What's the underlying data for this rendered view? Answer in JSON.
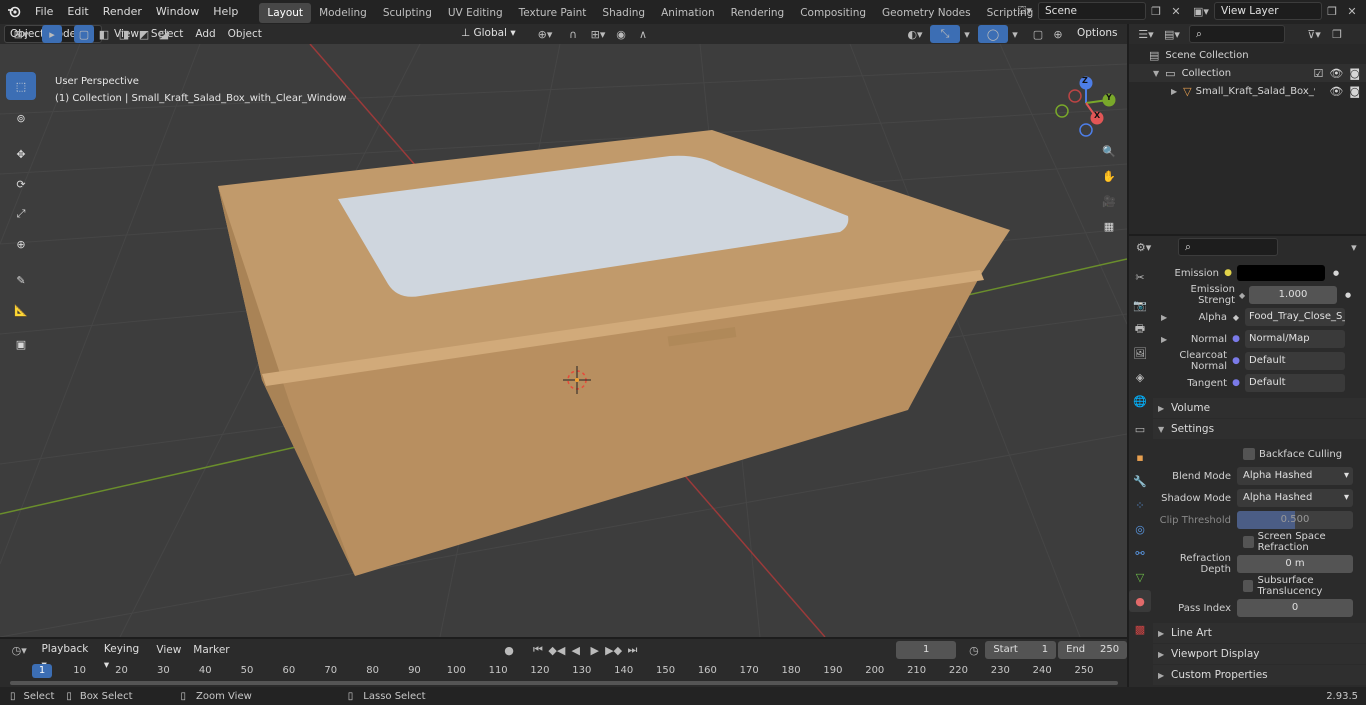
{
  "menus": [
    "File",
    "Edit",
    "Render",
    "Window",
    "Help"
  ],
  "workspaces": [
    "Layout",
    "Modeling",
    "Sculpting",
    "UV Editing",
    "Texture Paint",
    "Shading",
    "Animation",
    "Rendering",
    "Compositing",
    "Geometry Nodes",
    "Scripting"
  ],
  "active_workspace": "Layout",
  "scene_name": "Scene",
  "view_layer": "View Layer",
  "viewport": {
    "mode": "Object Mode",
    "header_menus": [
      "View",
      "Select",
      "Add",
      "Object"
    ],
    "orientation": "Global",
    "options_label": "Options",
    "perspective": "User Perspective",
    "collection_info": "(1) Collection | Small_Kraft_Salad_Box_with_Clear_Window"
  },
  "outliner": {
    "scene_collection": "Scene Collection",
    "collection": "Collection",
    "object": "Small_Kraft_Salad_Box_v"
  },
  "properties": {
    "emission_label": "Emission",
    "emission_color": "#000000",
    "emission_strength_label": "Emission Strengt",
    "emission_strength": "1.000",
    "alpha_label": "Alpha",
    "alpha_value": "Food_Tray_Close_S_...",
    "normal_label": "Normal",
    "normal_value": "Normal/Map",
    "clearcoat_label": "Clearcoat Normal",
    "clearcoat_value": "Default",
    "tangent_label": "Tangent",
    "tangent_value": "Default",
    "volume": "Volume",
    "settings": "Settings",
    "backface": "Backface Culling",
    "blend_mode_label": "Blend Mode",
    "blend_mode": "Alpha Hashed",
    "shadow_mode_label": "Shadow Mode",
    "shadow_mode": "Alpha Hashed",
    "clip_label": "Clip Threshold",
    "clip_value": "0.500",
    "clip_fraction": 0.5,
    "ssr": "Screen Space Refraction",
    "refraction_label": "Refraction Depth",
    "refraction_value": "0 m",
    "subsurface": "Subsurface Translucency",
    "pass_label": "Pass Index",
    "pass_value": "0",
    "line_art": "Line Art",
    "viewport_display": "Viewport Display",
    "custom_props": "Custom Properties"
  },
  "timeline": {
    "menus": [
      "Playback",
      "Keying",
      "View",
      "Marker"
    ],
    "current_frame": "1",
    "start_label": "Start",
    "start": "1",
    "end_label": "End",
    "end": "250",
    "ticks": [
      "1",
      "10",
      "20",
      "30",
      "40",
      "50",
      "60",
      "70",
      "80",
      "90",
      "100",
      "110",
      "120",
      "130",
      "140",
      "150",
      "160",
      "170",
      "180",
      "190",
      "200",
      "210",
      "220",
      "230",
      "240",
      "250"
    ]
  },
  "status": {
    "select": "Select",
    "box_select": "Box Select",
    "zoom_view": "Zoom View",
    "lasso_select": "Lasso Select",
    "version": "2.93.5"
  },
  "gizmo": {
    "x": "X",
    "y": "Y",
    "z": "Z"
  }
}
